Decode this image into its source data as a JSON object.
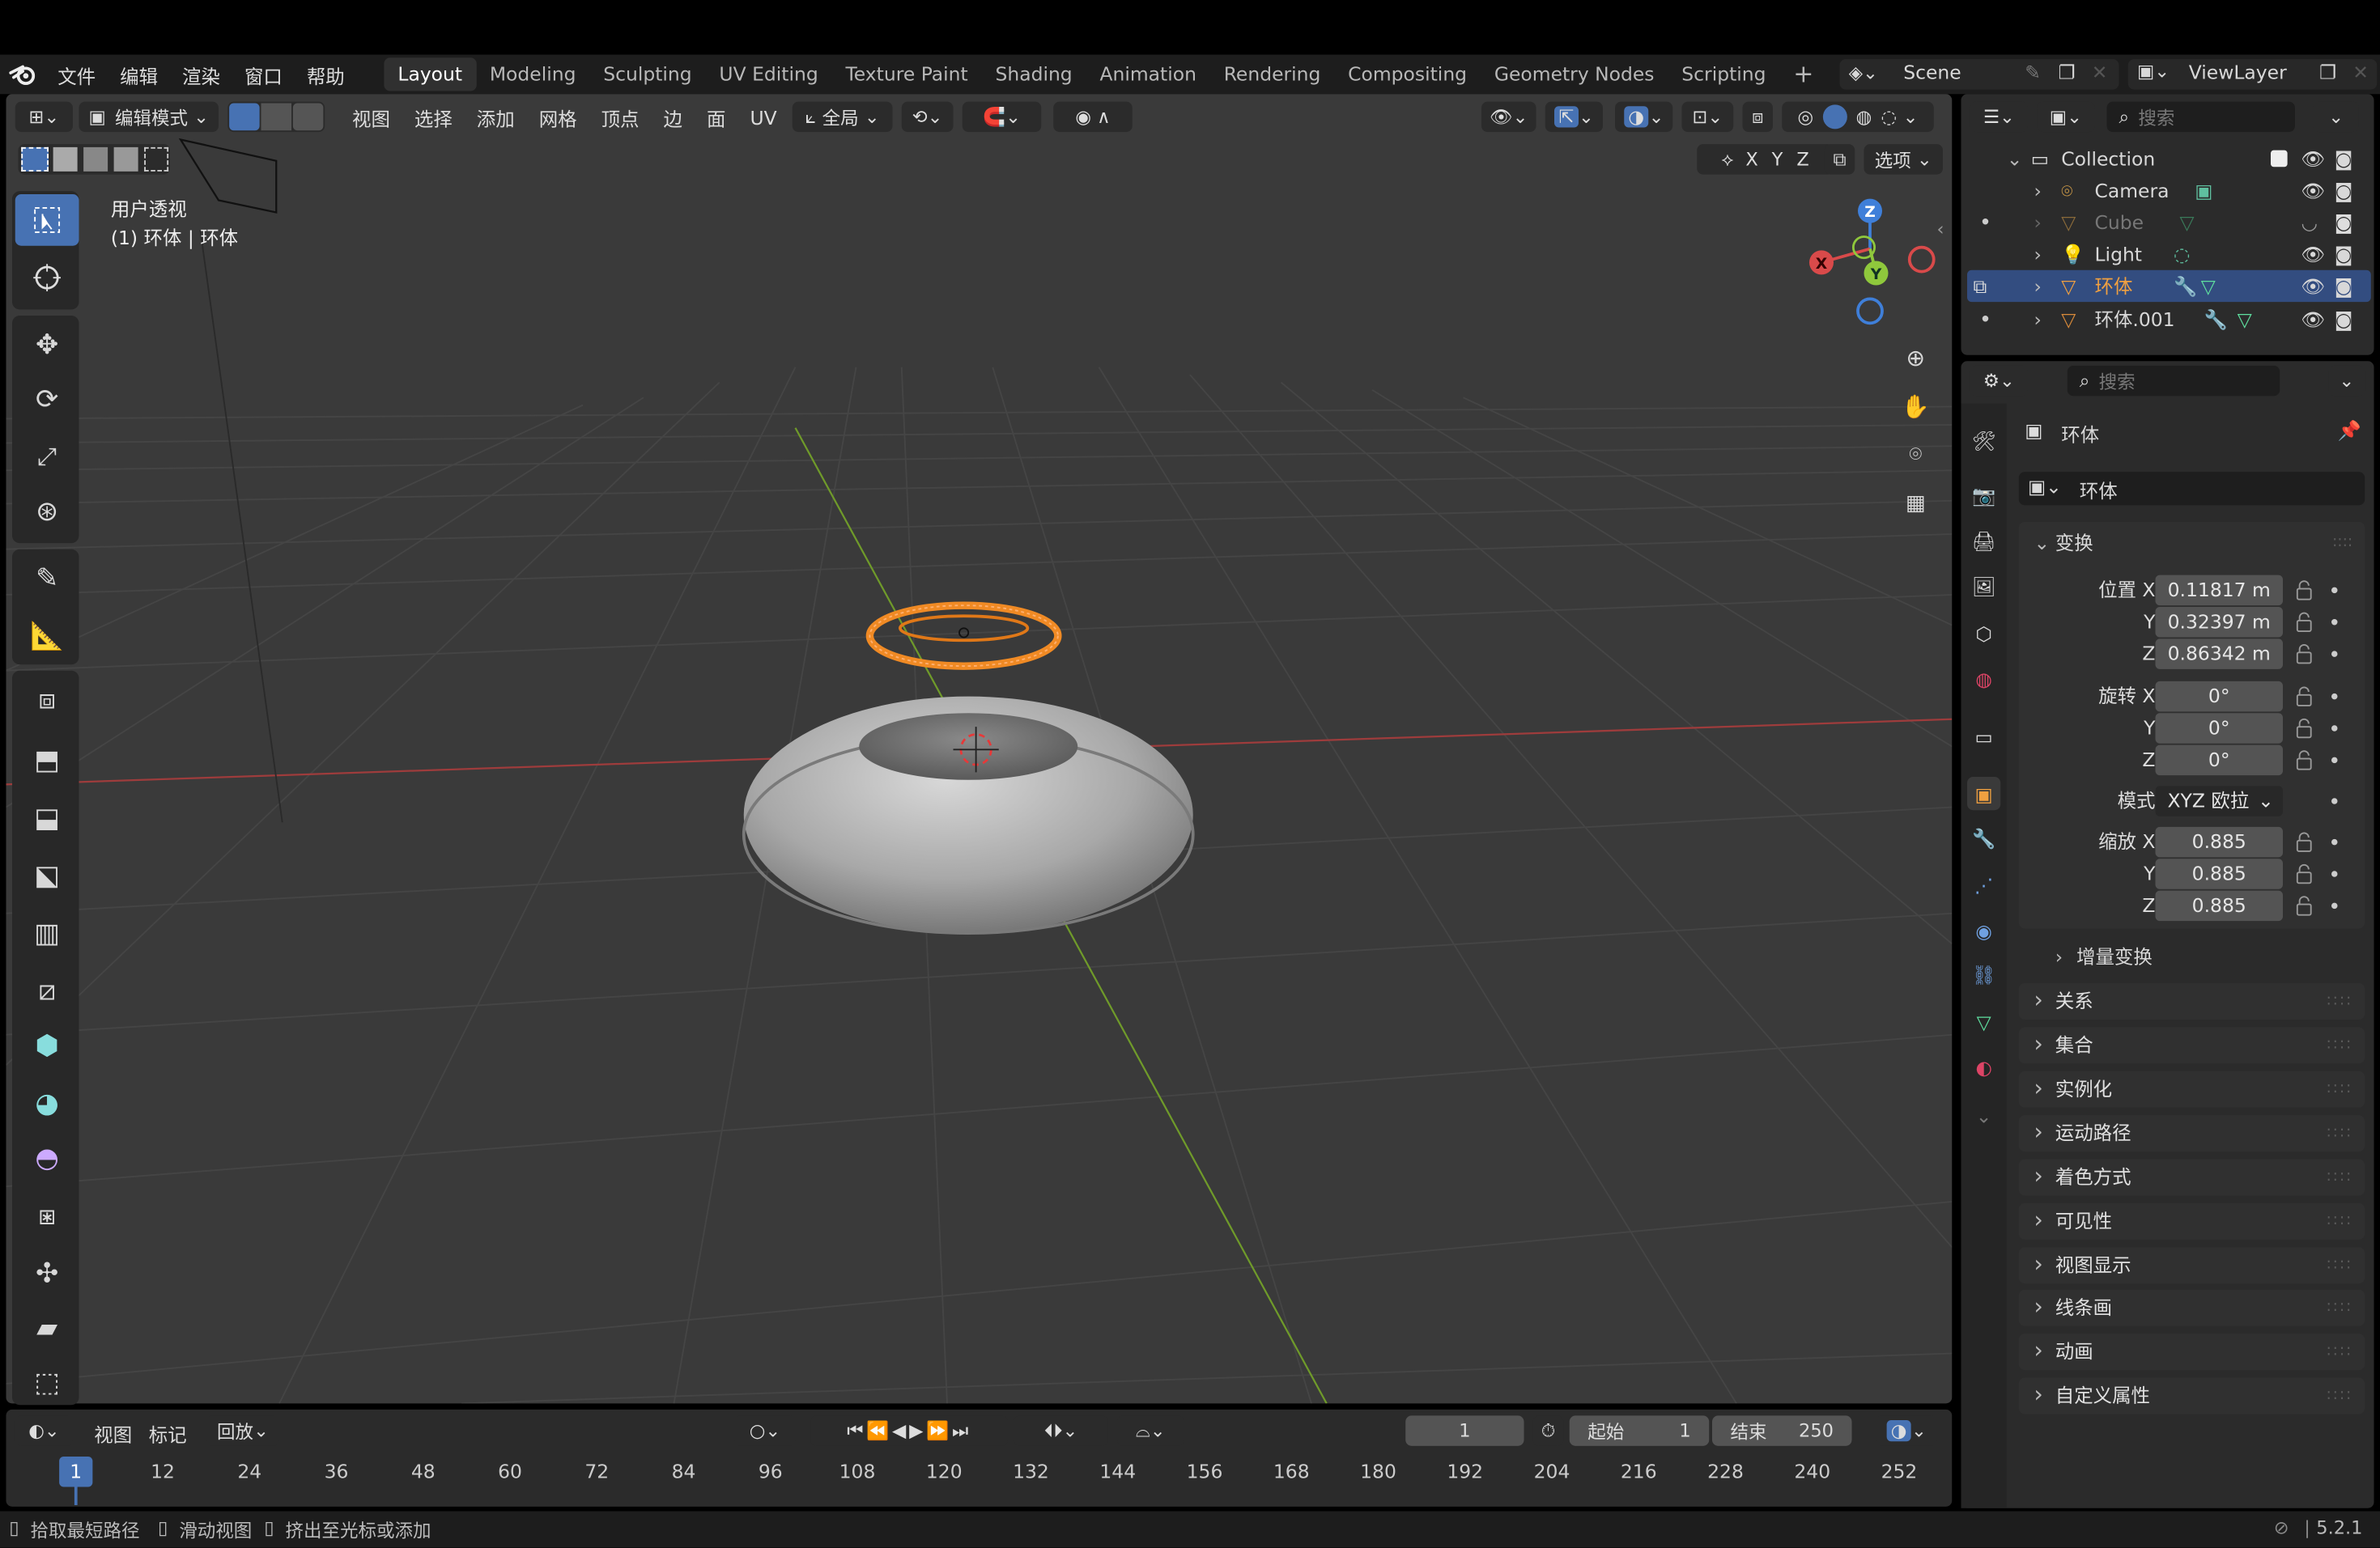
{
  "menubar": {
    "items": [
      "文件",
      "编辑",
      "渲染",
      "窗口",
      "帮助"
    ]
  },
  "workspaces": {
    "tabs": [
      "Layout",
      "Modeling",
      "Sculpting",
      "UV Editing",
      "Texture Paint",
      "Shading",
      "Animation",
      "Rendering",
      "Compositing",
      "Geometry Nodes",
      "Scripting"
    ],
    "active": "Layout"
  },
  "scene": {
    "name": "Scene",
    "view_layer": "ViewLayer"
  },
  "viewport_header": {
    "mode": "编辑模式",
    "menus": [
      "视图",
      "选择",
      "添加",
      "网格",
      "顶点",
      "边",
      "面",
      "UV"
    ],
    "transform_orientation": "全局",
    "axes": [
      "X",
      "Y",
      "Z"
    ],
    "options": "选项"
  },
  "viewport": {
    "view_name": "用户透视",
    "object_info": "(1) 环体 | 环体",
    "gizmo": {
      "x": "X",
      "y": "Y",
      "z": "Z"
    }
  },
  "outliner": {
    "search_placeholder": "搜索",
    "collection": "Collection",
    "items": [
      {
        "name": "Camera"
      },
      {
        "name": "Cube"
      },
      {
        "name": "Light"
      },
      {
        "name": "环体"
      },
      {
        "name": "环体.001"
      }
    ]
  },
  "properties": {
    "search_placeholder": "搜索",
    "object_title": "环体",
    "object_name": "环体",
    "transform_header": "变换",
    "location": {
      "label": "位置 X",
      "x": "0.11817 m",
      "y": "0.32397 m",
      "z": "0.86342 m"
    },
    "rotation": {
      "label": "旋转 X",
      "x": "0°",
      "y": "0°",
      "z": "0°"
    },
    "mode_label": "模式",
    "mode_value": "XYZ 欧拉",
    "scale": {
      "label": "缩放 X",
      "x": "0.885",
      "y": "0.885",
      "z": "0.885"
    },
    "axis_y": "Y",
    "axis_z": "Z",
    "delta": "增量变换",
    "sections": [
      "关系",
      "集合",
      "实例化",
      "运动路径",
      "着色方式",
      "可见性",
      "视图显示",
      "线条画",
      "动画",
      "自定义属性"
    ]
  },
  "timeline": {
    "menus": [
      "视图",
      "标记",
      "回放"
    ],
    "current_frame": "1",
    "start_label": "起始",
    "start": "1",
    "end_label": "结束",
    "end": "250",
    "ticks": [
      "1",
      "12",
      "24",
      "36",
      "48",
      "60",
      "72",
      "84",
      "96",
      "108",
      "120",
      "132",
      "144",
      "156",
      "168",
      "180",
      "192",
      "204",
      "216",
      "228",
      "240",
      "252"
    ]
  },
  "statusbar": {
    "hints": [
      "拾取最短路径",
      "滑动视图",
      "挤出至光标或添加"
    ],
    "version": "5.2.1"
  },
  "colors": {
    "accent": "#4772b3",
    "selected_orange": "#f08a24",
    "x_axis": "#d94a4a",
    "y_axis": "#8fc83c",
    "z_axis": "#3f7fd9"
  }
}
